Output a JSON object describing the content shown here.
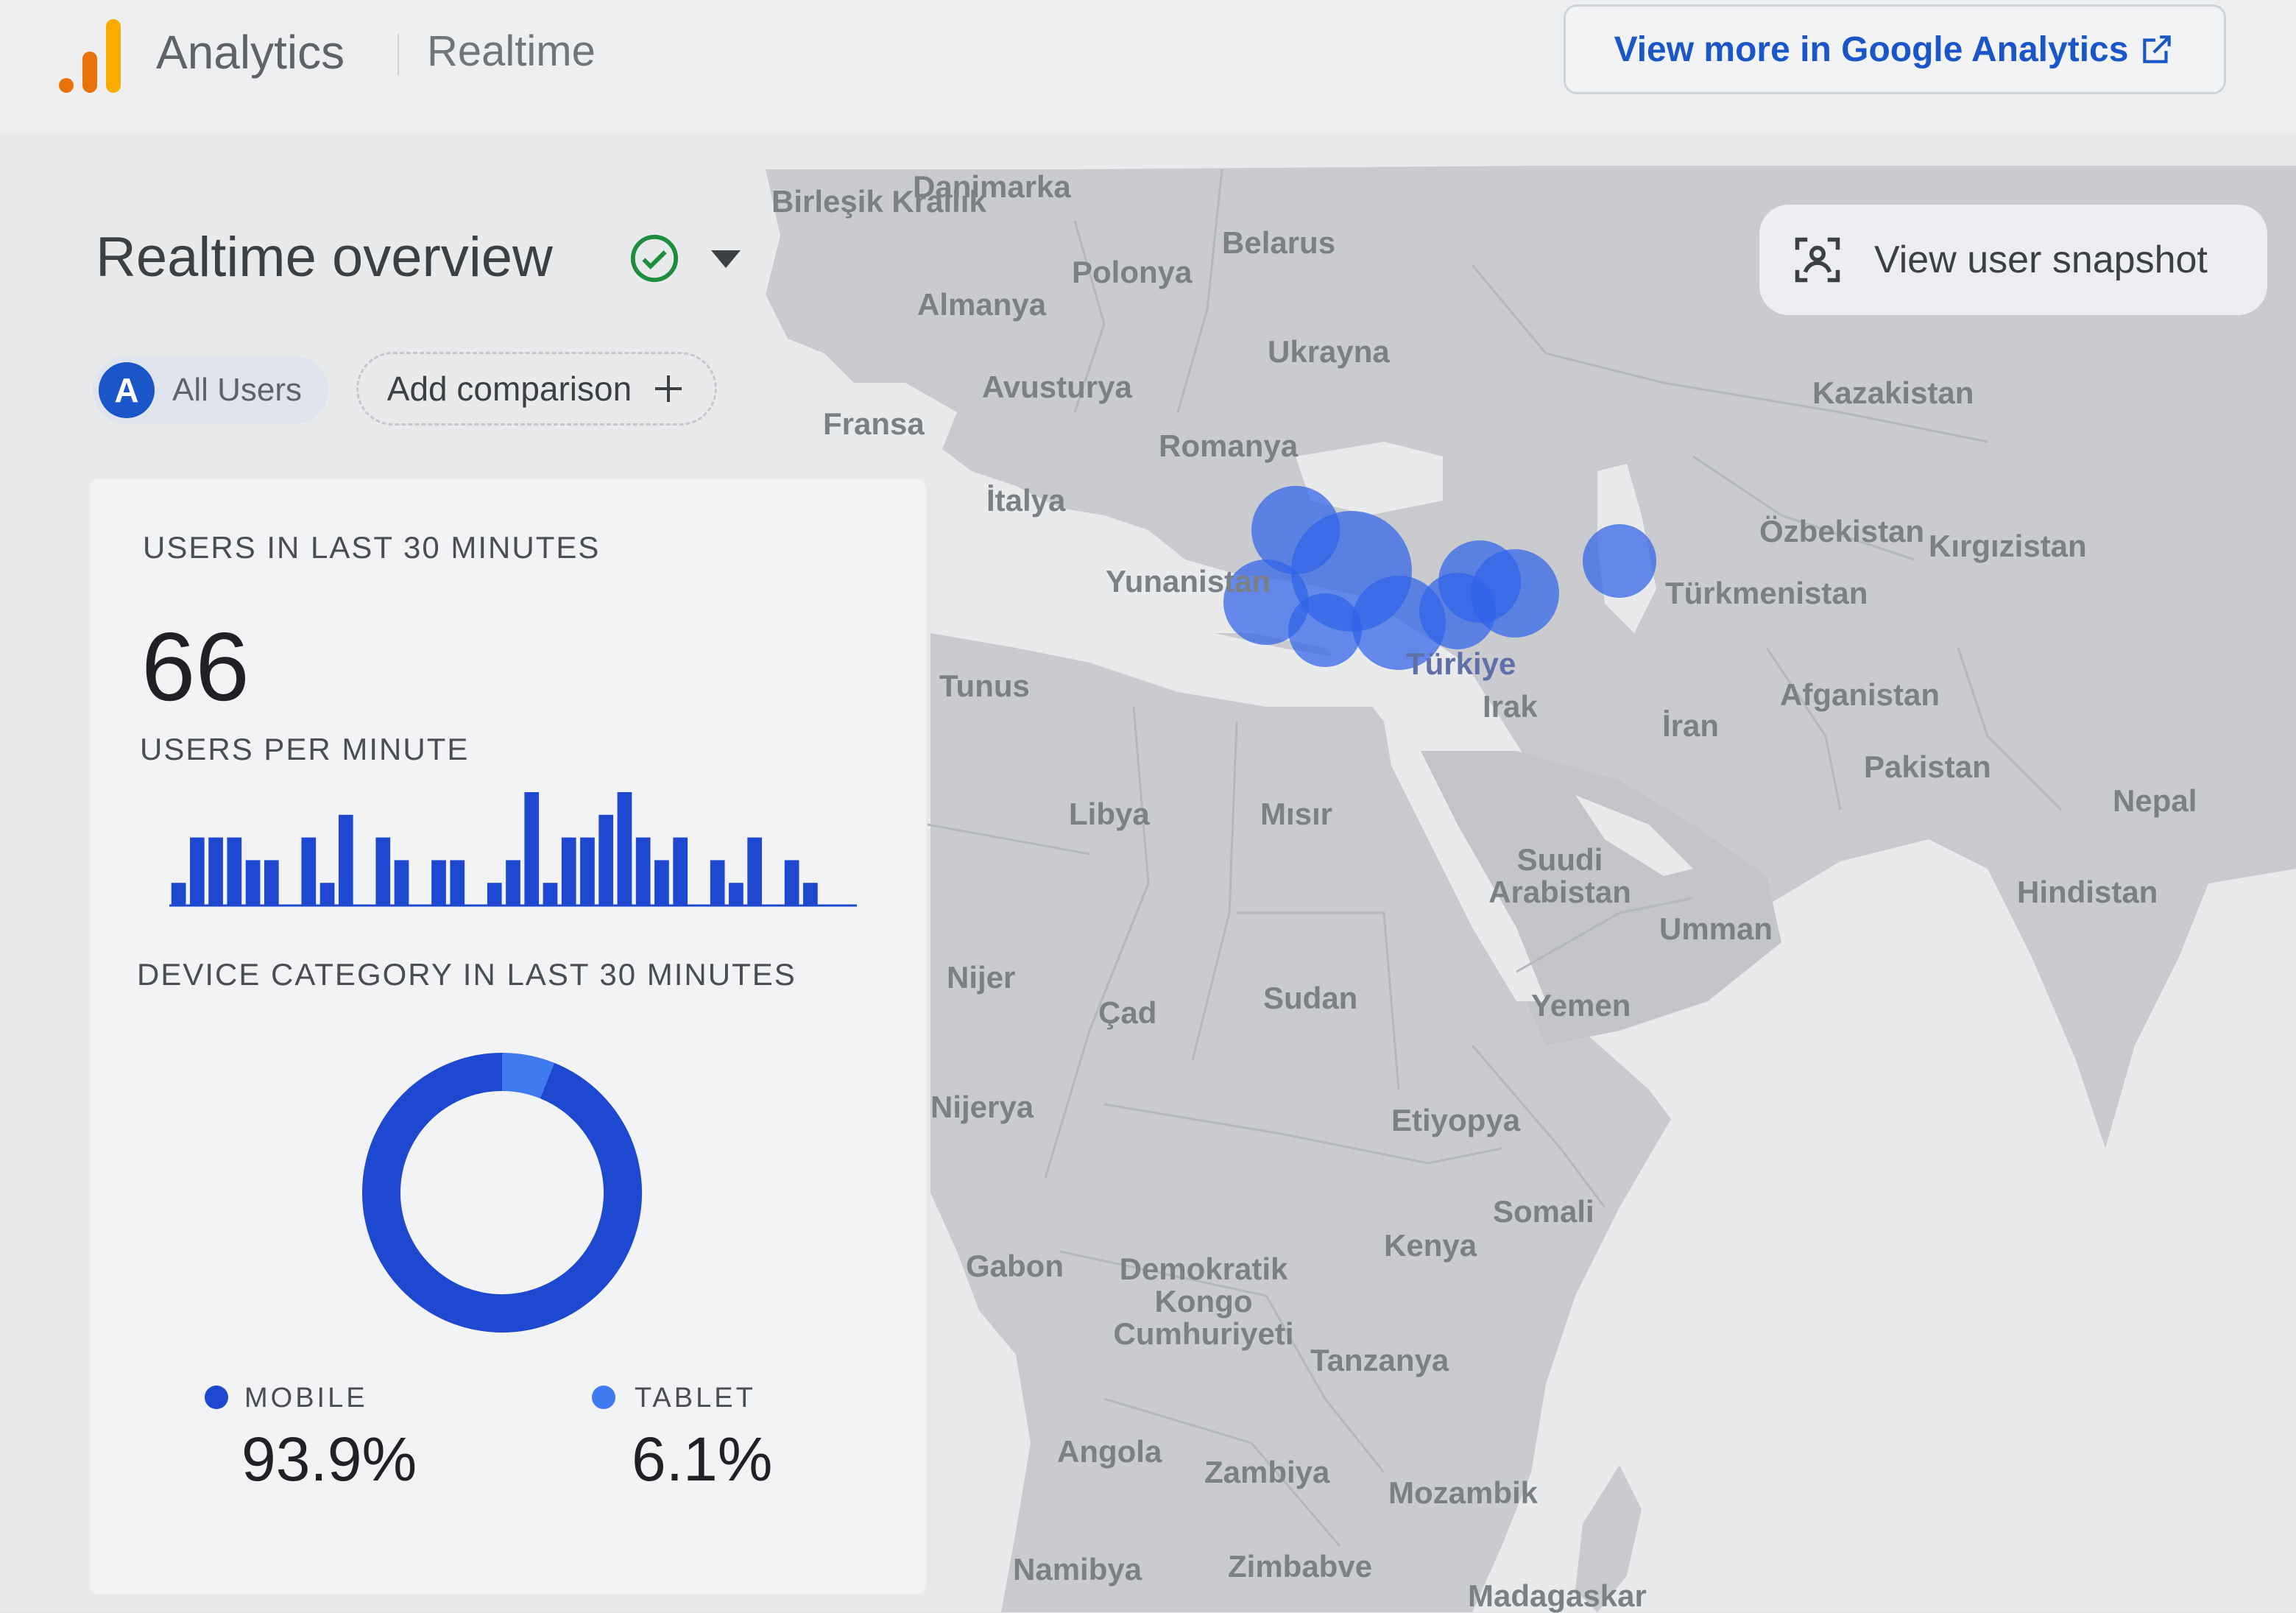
{
  "header": {
    "brand": "Analytics",
    "section": "Realtime",
    "ga_link": "View more in Google Analytics"
  },
  "overview": {
    "title": "Realtime overview",
    "segment_badge": "A",
    "segment_label": "All Users",
    "add_comparison": "Add comparison",
    "snapshot_button": "View user snapshot"
  },
  "card": {
    "users_title": "USERS IN LAST 30 MINUTES",
    "users_value": "66",
    "per_minute_title": "USERS PER MINUTE",
    "device_title": "DEVICE CATEGORY IN LAST 30 MINUTES",
    "devices": [
      {
        "label": "MOBILE",
        "value": "93.9%",
        "color": "#1e48cf"
      },
      {
        "label": "TABLET",
        "value": "6.1%",
        "color": "#3f7bf0"
      }
    ]
  },
  "chart_data": [
    {
      "type": "bar",
      "values": [
        1,
        3,
        3,
        3,
        2,
        2,
        0,
        3,
        1,
        4,
        0,
        3,
        2,
        0,
        2,
        2,
        0,
        1,
        2,
        5,
        1,
        3,
        3,
        4,
        5,
        3,
        2,
        3,
        0,
        2,
        1,
        3,
        0,
        2,
        1,
        0,
        0
      ],
      "ylim": [
        0,
        5
      ]
    },
    {
      "type": "pie",
      "categories": [
        "MOBILE",
        "TABLET"
      ],
      "values": [
        93.9,
        6.1
      ]
    }
  ],
  "map": {
    "countries": [
      "Birleşik Krallık",
      "Danimarka",
      "Belarus",
      "Polonya",
      "Almanya",
      "Ukrayna",
      "Avusturya",
      "Fransa",
      "Romanya",
      "Kazakistan",
      "İtalya",
      "Özbekistan",
      "Kırgızistan",
      "Yunanistan",
      "Türkmenistan",
      "Türkiye",
      "Tunus",
      "Irak",
      "İran",
      "Afganistan",
      "Pakistan",
      "Nepal",
      "Libya",
      "Mısır",
      "Suudi Arabistan",
      "Hindistan",
      "Umman",
      "Nijer",
      "Çad",
      "Sudan",
      "Yemen",
      "Nijerya",
      "Etiyopya",
      "Somali",
      "Kenya",
      "Gabon",
      "Demokratik Kongo Cumhuriyeti",
      "Tanzanya",
      "Angola",
      "Zambiya",
      "Mozambik",
      "Namibya",
      "Zimbabve",
      "Madagaskar"
    ]
  }
}
